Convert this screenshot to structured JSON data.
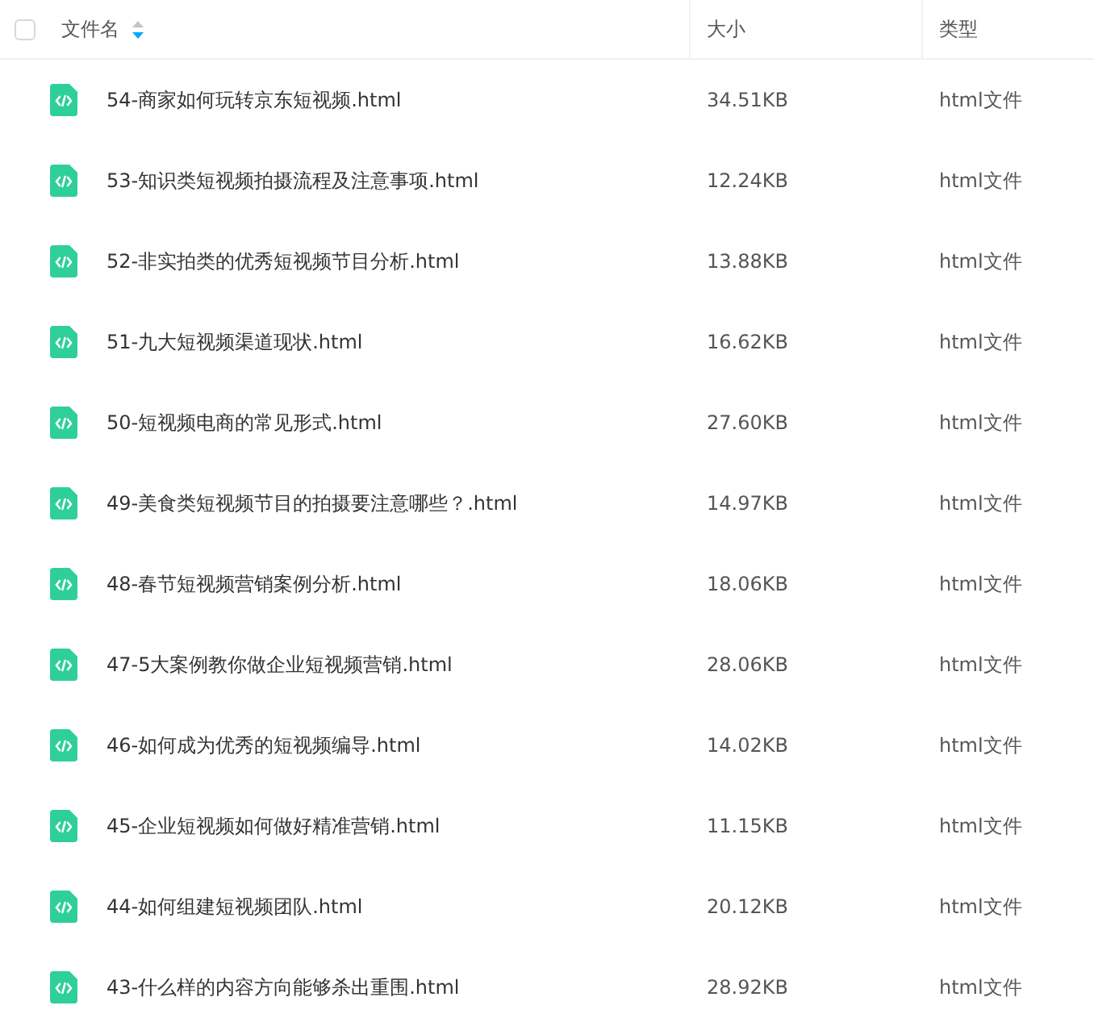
{
  "header": {
    "select_all": {
      "checked": false
    },
    "columns": [
      {
        "label": "文件名",
        "sorted": true,
        "descending": true
      },
      {
        "label": "大小"
      },
      {
        "label": "类型"
      }
    ]
  },
  "rows": [
    {
      "name": "54-商家如何玩转京东短视频.html",
      "size": "34.51KB",
      "type": "html文件"
    },
    {
      "name": "53-知识类短视频拍摄流程及注意事项.html",
      "size": "12.24KB",
      "type": "html文件"
    },
    {
      "name": "52-非实拍类的优秀短视频节目分析.html",
      "size": "13.88KB",
      "type": "html文件"
    },
    {
      "name": "51-九大短视频渠道现状.html",
      "size": "16.62KB",
      "type": "html文件"
    },
    {
      "name": "50-短视频电商的常见形式.html",
      "size": "27.60KB",
      "type": "html文件"
    },
    {
      "name": "49-美食类短视频节目的拍摄要注意哪些？.html",
      "size": "14.97KB",
      "type": "html文件"
    },
    {
      "name": "48-春节短视频营销案例分析.html",
      "size": "18.06KB",
      "type": "html文件"
    },
    {
      "name": "47-5大案例教你做企业短视频营销.html",
      "size": "28.06KB",
      "type": "html文件"
    },
    {
      "name": "46-如何成为优秀的短视频编导.html",
      "size": "14.02KB",
      "type": "html文件"
    },
    {
      "name": "45-企业短视频如何做好精准营销.html",
      "size": "11.15KB",
      "type": "html文件"
    },
    {
      "name": "44-如何组建短视频团队.html",
      "size": "20.12KB",
      "type": "html文件"
    },
    {
      "name": "43-什么样的内容方向能够杀出重围.html",
      "size": "28.92KB",
      "type": "html文件"
    }
  ]
}
